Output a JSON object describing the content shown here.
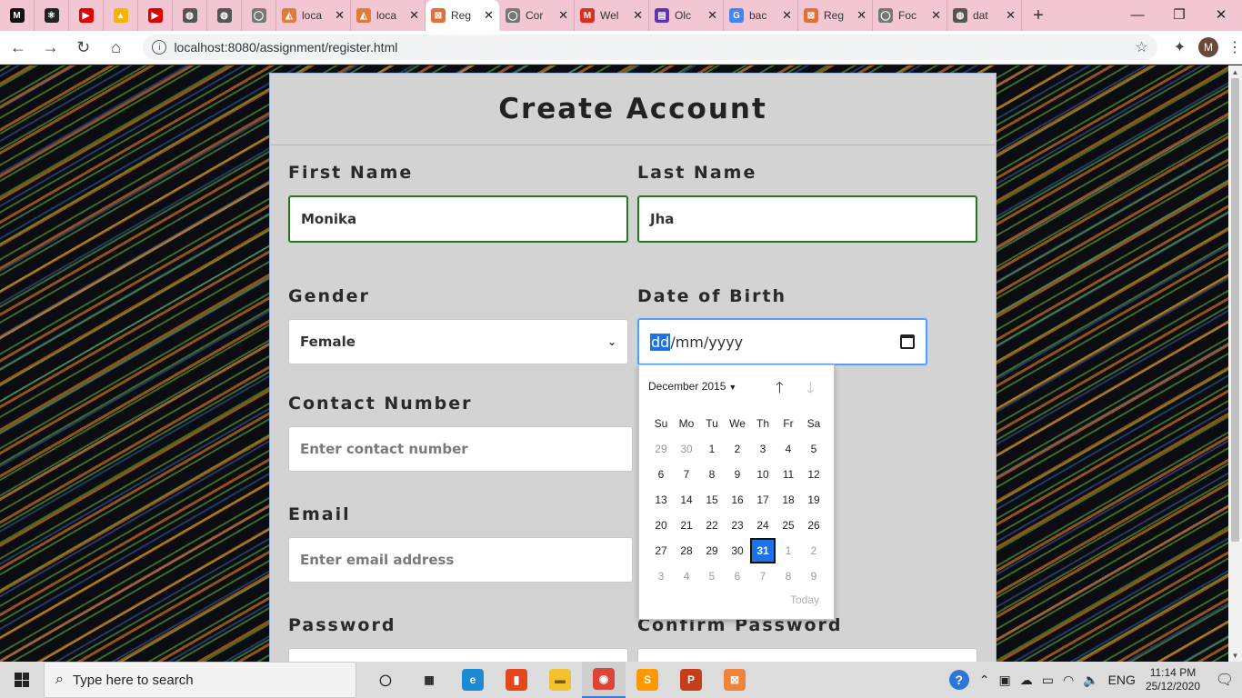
{
  "browser": {
    "tabs": [
      {
        "kind": "pinned",
        "icon": "medium-icon",
        "color": "#111111",
        "glyph": "M"
      },
      {
        "kind": "pinned",
        "icon": "react-icon",
        "color": "#222222",
        "glyph": "⚛"
      },
      {
        "kind": "pinned",
        "icon": "youtube-icon",
        "color": "#e00000",
        "glyph": "▶"
      },
      {
        "kind": "pinned",
        "icon": "drive-icon",
        "color": "#f4b400",
        "glyph": "▲"
      },
      {
        "kind": "pinned",
        "icon": "youtube-icon",
        "color": "#e00000",
        "glyph": "▶"
      },
      {
        "kind": "pinned",
        "icon": "globe-icon",
        "color": "#555555",
        "glyph": "◍"
      },
      {
        "kind": "pinned",
        "icon": "globe-icon",
        "color": "#555555",
        "glyph": "◍"
      },
      {
        "kind": "pinned",
        "icon": "github-icon",
        "color": "#777777",
        "glyph": "◯"
      },
      {
        "kind": "regular",
        "icon": "phpmyadmin-icon",
        "color": "#e07b39",
        "glyph": "◭",
        "label": "loca"
      },
      {
        "kind": "regular",
        "icon": "phpmyadmin-icon",
        "color": "#e07b39",
        "glyph": "◭",
        "label": "loca"
      },
      {
        "kind": "active",
        "icon": "xampp-icon",
        "color": "#e0703a",
        "glyph": "⊠",
        "label": "Reg"
      },
      {
        "kind": "regular",
        "icon": "github-icon",
        "color": "#777777",
        "glyph": "◯",
        "label": "Cor"
      },
      {
        "kind": "regular",
        "icon": "gmail-icon",
        "color": "#d93025",
        "glyph": "M",
        "label": "Wel"
      },
      {
        "kind": "regular",
        "icon": "form-icon",
        "color": "#5e35b1",
        "glyph": "▤",
        "label": "Olc"
      },
      {
        "kind": "regular",
        "icon": "google-icon",
        "color": "#4285f4",
        "glyph": "G",
        "label": "bac"
      },
      {
        "kind": "regular",
        "icon": "xampp-icon",
        "color": "#e0703a",
        "glyph": "⊠",
        "label": "Reg"
      },
      {
        "kind": "regular",
        "icon": "github-icon",
        "color": "#777777",
        "glyph": "◯",
        "label": "Foc"
      },
      {
        "kind": "regular",
        "icon": "globe-icon",
        "color": "#555555",
        "glyph": "◍",
        "label": "dat"
      }
    ],
    "url": "localhost:8080/assignment/register.html",
    "avatar_letter": "M"
  },
  "form": {
    "title": "Create Account",
    "first_name_label": "First Name",
    "first_name_value": "Monika",
    "last_name_label": "Last Name",
    "last_name_value": "Jha",
    "gender_label": "Gender",
    "gender_value": "Female",
    "dob_label": "Date of Birth",
    "dob_dd": "dd",
    "dob_rest": "/mm/yyyy",
    "contact_label": "Contact Number",
    "contact_placeholder": "Enter contact number",
    "email_label": "Email",
    "email_placeholder": "Enter email address",
    "password_label": "Password",
    "confirm_label": "Confirm Password"
  },
  "datepicker": {
    "month_label": "December 2015",
    "weekdays": [
      "Su",
      "Mo",
      "Tu",
      "We",
      "Th",
      "Fr",
      "Sa"
    ],
    "weeks": [
      [
        {
          "d": "29",
          "m": true
        },
        {
          "d": "30",
          "m": true
        },
        {
          "d": "1"
        },
        {
          "d": "2"
        },
        {
          "d": "3"
        },
        {
          "d": "4"
        },
        {
          "d": "5"
        }
      ],
      [
        {
          "d": "6"
        },
        {
          "d": "7"
        },
        {
          "d": "8"
        },
        {
          "d": "9"
        },
        {
          "d": "10"
        },
        {
          "d": "11"
        },
        {
          "d": "12"
        }
      ],
      [
        {
          "d": "13"
        },
        {
          "d": "14"
        },
        {
          "d": "15"
        },
        {
          "d": "16"
        },
        {
          "d": "17"
        },
        {
          "d": "18"
        },
        {
          "d": "19"
        }
      ],
      [
        {
          "d": "20"
        },
        {
          "d": "21"
        },
        {
          "d": "22"
        },
        {
          "d": "23"
        },
        {
          "d": "24"
        },
        {
          "d": "25"
        },
        {
          "d": "26"
        }
      ],
      [
        {
          "d": "27"
        },
        {
          "d": "28"
        },
        {
          "d": "29"
        },
        {
          "d": "30"
        },
        {
          "d": "31",
          "s": true
        },
        {
          "d": "1",
          "m": true
        },
        {
          "d": "2",
          "m": true
        }
      ],
      [
        {
          "d": "3",
          "m": true
        },
        {
          "d": "4",
          "m": true
        },
        {
          "d": "5",
          "m": true
        },
        {
          "d": "6",
          "m": true
        },
        {
          "d": "7",
          "m": true
        },
        {
          "d": "8",
          "m": true
        },
        {
          "d": "9",
          "m": true
        }
      ]
    ],
    "today_label": "Today"
  },
  "taskbar": {
    "search_placeholder": "Type here to search",
    "apps": [
      {
        "name": "task-view-icon",
        "color": "#dcdcdc",
        "glyph": "◯",
        "fg": "#222"
      },
      {
        "name": "task-switch-icon",
        "color": "#dcdcdc",
        "glyph": "▦",
        "fg": "#222"
      },
      {
        "name": "edge-icon",
        "color": "#1b8ad3",
        "glyph": "e",
        "fg": "#fff"
      },
      {
        "name": "office-icon",
        "color": "#e2481c",
        "glyph": "▮",
        "fg": "#fff"
      },
      {
        "name": "file-explorer-icon",
        "color": "#f2c230",
        "glyph": "▬",
        "fg": "#7a5a00"
      },
      {
        "name": "chrome-icon",
        "color": "#db4437",
        "glyph": "◉",
        "fg": "#fff",
        "active": true
      },
      {
        "name": "sublime-icon",
        "color": "#ff9800",
        "glyph": "S",
        "fg": "#fff"
      },
      {
        "name": "powerpoint-icon",
        "color": "#c43e1c",
        "glyph": "P",
        "fg": "#fff"
      },
      {
        "name": "xampp-icon",
        "color": "#f0823b",
        "glyph": "⊠",
        "fg": "#fff"
      }
    ],
    "language": "ENG",
    "time": "11:14 PM",
    "date": "25/12/2020"
  }
}
